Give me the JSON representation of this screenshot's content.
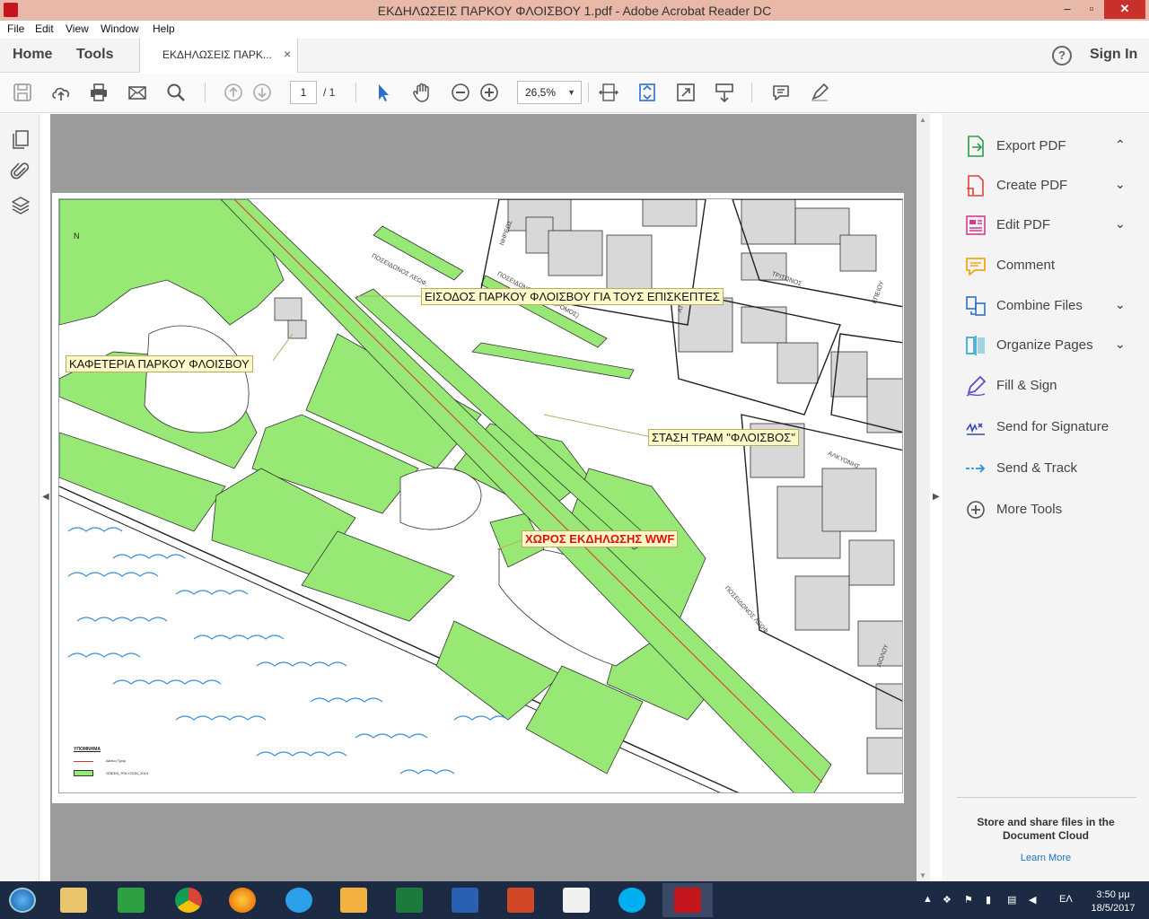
{
  "window": {
    "title": "ΕΚΔΗΛΩΣΕΙΣ ΠΑΡΚΟΥ ΦΛΟΙΣΒΟΥ 1.pdf - Adobe Acrobat Reader DC",
    "minimize": "–",
    "maximize": "▫",
    "close": "✕"
  },
  "menu": [
    "File",
    "Edit",
    "View",
    "Window",
    "Help"
  ],
  "tabs": {
    "home": "Home",
    "tools": "Tools",
    "document": "ΕΚΔΗΛΩΣΕΙΣ ΠΑΡΚ...",
    "document_close": "×"
  },
  "header": {
    "help": "?",
    "sign_in": "Sign In"
  },
  "toolbar": {
    "page_current": "1",
    "page_total": "/  1",
    "zoom": "26,5%",
    "zoom_caret": "▼"
  },
  "map": {
    "north": "N",
    "callouts": [
      "ΕΙΣΟΔΟΣ ΠΑΡΚΟΥ ΦΛΟΙΣΒΟΥ ΓΙΑ ΤΟΥΣ ΕΠΙΣΚΕΠΤΕΣ",
      "ΚΑΦΕΤΕΡΙΑ ΠΑΡΚΟΥ ΦΛΟΙΣΒΟΥ",
      "ΣΤΑΣΗ ΤΡΑΜ \"ΦΛΟΙΣΒΟΣ\"",
      "ΧΩΡΟΣ ΕΚΔΗΛΩΣΗΣ WWF"
    ],
    "streets": [
      "ΠΟΣΕΙΔΩΝΟΣ ΛΕΩΦ.",
      "ΠΟΣΕΙΔΩΝΟΣ (ΠΑΡΑΔΡΟΜΟΣ)",
      "ΝΗΡΕΩΣ",
      "ΤΡΙΤΩΝΟΣ",
      "ΑΛΚΥΟΝΗΣ",
      "ΑΙΟΛΟΥ",
      "ΠΟΣΕΙΔΩΝΟΣ ΛΕΩΦ.",
      "ΕΠΕΙΟΥ",
      "ΑΤ"
    ],
    "legend": {
      "title": "ΥΠΟΜΝΗΜΑ",
      "tram": "Δίκτυο Τραμ",
      "green": "GREEN_POLYGON_2014"
    }
  },
  "tools_panel": {
    "items": [
      {
        "label": "Export PDF",
        "caret": "⌃",
        "color": "#2d9b47"
      },
      {
        "label": "Create PDF",
        "caret": "⌄",
        "color": "#e4403b"
      },
      {
        "label": "Edit PDF",
        "caret": "⌄",
        "color": "#d43b8f"
      },
      {
        "label": "Comment",
        "caret": "",
        "color": "#f2a516"
      },
      {
        "label": "Combine Files",
        "caret": "⌄",
        "color": "#2b6fc9"
      },
      {
        "label": "Organize Pages",
        "caret": "⌄",
        "color": "#2ba3c9"
      },
      {
        "label": "Fill & Sign",
        "caret": "",
        "color": "#5a4fc4"
      },
      {
        "label": "Send for Signature",
        "caret": "",
        "color": "#3a47b8"
      },
      {
        "label": "Send & Track",
        "caret": "",
        "color": "#2b8fd9"
      },
      {
        "label": "More Tools",
        "caret": "",
        "color": "#555555"
      }
    ],
    "cloud_text": "Store and share files in the Document Cloud",
    "learn_more": "Learn More"
  },
  "taskbar": {
    "language": "ΕΛ",
    "time": "3:50 μμ",
    "date": "18/5/2017"
  }
}
